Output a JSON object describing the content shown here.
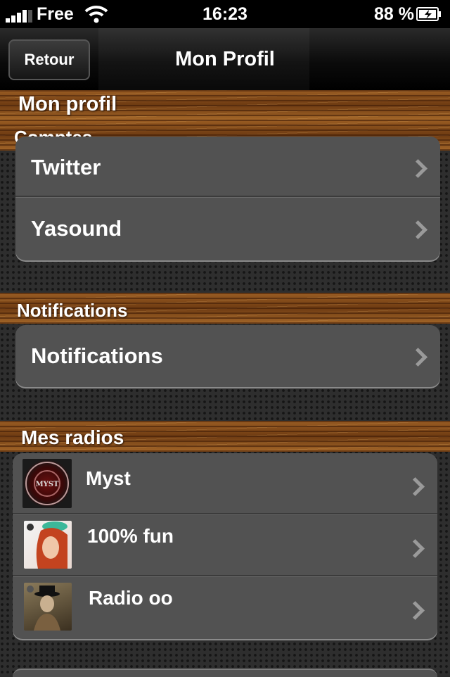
{
  "status_bar": {
    "carrier": "Free",
    "time": "16:23",
    "battery": "88 %"
  },
  "nav": {
    "back_label": "Retour",
    "title": "Mon Profil"
  },
  "sections": {
    "profile": "Mon profil",
    "accounts": "Comptes",
    "notifications": "Notifications",
    "radios": "Mes radios"
  },
  "accounts": [
    {
      "label": "Twitter"
    },
    {
      "label": "Yasound"
    }
  ],
  "notifications": [
    {
      "label": "Notifications"
    }
  ],
  "radios": [
    {
      "name": "Myst",
      "thumb_text": "MYST"
    },
    {
      "name": "100% fun"
    },
    {
      "name": "Radio oo"
    }
  ]
}
